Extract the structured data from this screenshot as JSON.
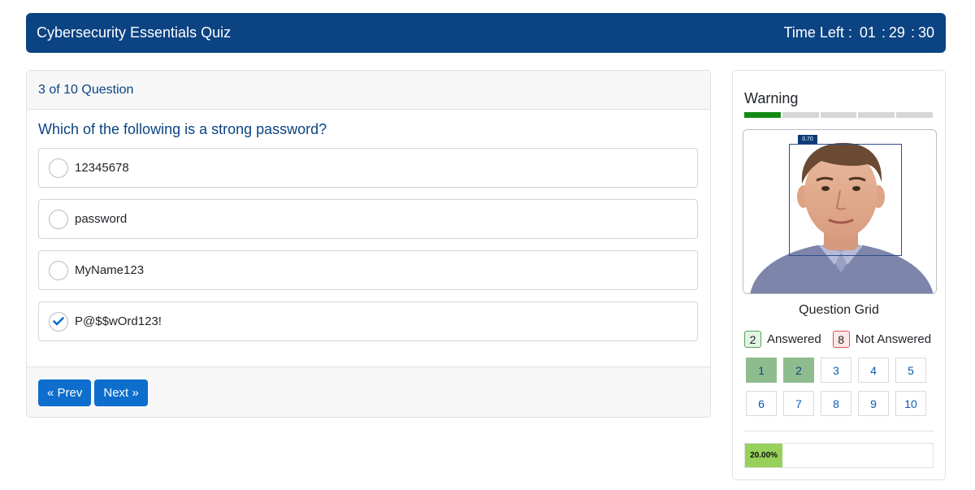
{
  "header": {
    "title": "Cybersecurity Essentials Quiz",
    "time_left_label": "Time Left :",
    "hours": "01",
    "minutes": "29",
    "seconds": "30",
    "separator": ":"
  },
  "quiz": {
    "counter": "3 of 10 Question",
    "question": "Which of the following is a strong password?",
    "options": [
      {
        "label": "12345678",
        "selected": false
      },
      {
        "label": "password",
        "selected": false
      },
      {
        "label": "MyName123",
        "selected": false
      },
      {
        "label": "P@$$wOrd123!",
        "selected": true
      }
    ],
    "prev_label": "« Prev",
    "next_label": "Next »"
  },
  "sidebar": {
    "warning_title": "Warning",
    "warning_level": 1,
    "warning_segments": 5,
    "camera": {
      "face_confidence": "0.70"
    },
    "grid_title": "Question Grid",
    "legend": {
      "answered_count": "2",
      "answered_label": "Answered",
      "not_answered_count": "8",
      "not_answered_label": "Not Answered"
    },
    "questions": [
      {
        "num": "1",
        "answered": true
      },
      {
        "num": "2",
        "answered": true
      },
      {
        "num": "3",
        "answered": false
      },
      {
        "num": "4",
        "answered": false
      },
      {
        "num": "5",
        "answered": false
      },
      {
        "num": "6",
        "answered": false
      },
      {
        "num": "7",
        "answered": false
      },
      {
        "num": "8",
        "answered": false
      },
      {
        "num": "9",
        "answered": false
      },
      {
        "num": "10",
        "answered": false
      }
    ],
    "progress_value": 0.2,
    "progress_label": "20.00%"
  },
  "colors": {
    "brand": "#0b4383",
    "button": "#0d6ecd",
    "answered": "#8fbc8f",
    "progress": "#97d05a",
    "warning_active": "#138a13"
  }
}
